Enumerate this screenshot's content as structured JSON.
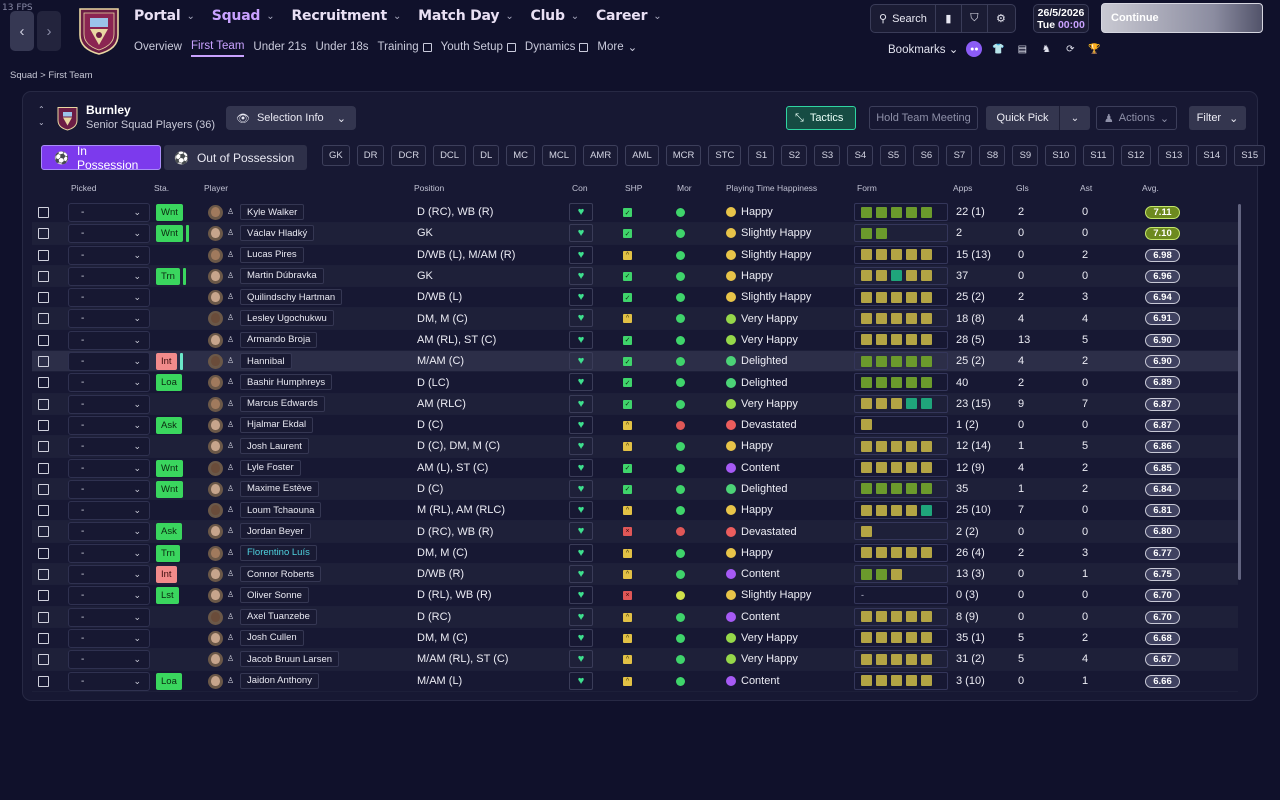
{
  "fps": "13 FPS",
  "menu": [
    {
      "label": "Portal",
      "active": false
    },
    {
      "label": "Squad",
      "active": true
    },
    {
      "label": "Recruitment",
      "active": false
    },
    {
      "label": "Match Day",
      "active": false
    },
    {
      "label": "Club",
      "active": false
    },
    {
      "label": "Career",
      "active": false
    }
  ],
  "submenu": [
    {
      "label": "Overview",
      "active": false,
      "ext": false
    },
    {
      "label": "First Team",
      "active": true,
      "ext": false
    },
    {
      "label": "Under 21s",
      "active": false,
      "ext": false
    },
    {
      "label": "Under 18s",
      "active": false,
      "ext": false
    },
    {
      "label": "Training",
      "active": false,
      "ext": true
    },
    {
      "label": "Youth Setup",
      "active": false,
      "ext": true
    },
    {
      "label": "Dynamics",
      "active": false,
      "ext": true
    },
    {
      "label": "More",
      "active": false,
      "ext": false,
      "dropdown": true
    }
  ],
  "topbar": {
    "search_label": "Search",
    "date": "26/5/2026",
    "day": "Tue",
    "time": "00:00",
    "continue_label": "Continue",
    "bookmarks_label": "Bookmarks"
  },
  "breadcrumb": {
    "root": "Squad",
    "current": "First Team"
  },
  "team": {
    "name": "Burnley",
    "subtitle": "Senior Squad Players (36)"
  },
  "buttons": {
    "selection_info": "Selection Info",
    "tactics": "Tactics",
    "hold_meeting": "Hold Team Meeting",
    "quick_pick": "Quick Pick",
    "actions": "Actions",
    "filter": "Filter",
    "in_possession": "In Possession",
    "out_possession": "Out of Possession"
  },
  "positions": [
    "GK",
    "DR",
    "DCR",
    "DCL",
    "DL",
    "MC",
    "MCL",
    "AMR",
    "AML",
    "MCR",
    "STC",
    "S1",
    "S2",
    "S3",
    "S4",
    "S5",
    "S6",
    "S7",
    "S8",
    "S9",
    "S10",
    "S11",
    "S12",
    "S13",
    "S14",
    "S15"
  ],
  "columns": {
    "picked": "Picked",
    "sta": "Sta.",
    "player": "Player",
    "position": "Position",
    "con": "Con",
    "shp": "SHP",
    "mor": "Mor",
    "happiness": "Playing Time Happiness",
    "form": "Form",
    "apps": "Apps",
    "gls": "Gls",
    "ast": "Ast",
    "avg": "Avg."
  },
  "picked_default": "-",
  "players": [
    {
      "name": "Kyle Walker",
      "sta": "Wnt",
      "sta_c": "g",
      "bar": "",
      "pos": "D (RC), WB (R)",
      "shp": "g",
      "mor": "g",
      "hap": "Happy",
      "emo": "y",
      "form": [
        "o",
        "o",
        "o",
        "o",
        "o"
      ],
      "apps": "22 (1)",
      "gls": "2",
      "ast": "0",
      "avg": "7.11",
      "avgc": "gr",
      "skin": "md"
    },
    {
      "name": "Václav Hladký",
      "sta": "Wnt",
      "sta_c": "g",
      "bar": "g",
      "pos": "GK",
      "shp": "g",
      "mor": "g",
      "hap": "Slightly Happy",
      "emo": "y",
      "form": [
        "o",
        "o"
      ],
      "apps": "2",
      "gls": "0",
      "ast": "0",
      "avg": "7.10",
      "avgc": "gr",
      "skin": ""
    },
    {
      "name": "Lucas Pires",
      "sta": "",
      "sta_c": "",
      "bar": "",
      "pos": "D/WB (L), M/AM (R)",
      "shp": "y",
      "mor": "g",
      "hap": "Slightly Happy",
      "emo": "y",
      "form": [
        "y",
        "y",
        "y",
        "y",
        "y"
      ],
      "apps": "15 (13)",
      "gls": "0",
      "ast": "2",
      "avg": "6.98",
      "avgc": "",
      "skin": "md"
    },
    {
      "name": "Martin Dúbravka",
      "sta": "Trn",
      "sta_c": "g",
      "bar": "g",
      "pos": "GK",
      "shp": "g",
      "mor": "g",
      "hap": "Happy",
      "emo": "y",
      "form": [
        "y",
        "y",
        "t",
        "y",
        "y"
      ],
      "apps": "37",
      "gls": "0",
      "ast": "0",
      "avg": "6.96",
      "avgc": "",
      "skin": ""
    },
    {
      "name": "Quilindschy Hartman",
      "sta": "",
      "sta_c": "",
      "bar": "",
      "pos": "D/WB (L)",
      "shp": "g",
      "mor": "g",
      "hap": "Slightly Happy",
      "emo": "y",
      "form": [
        "y",
        "y",
        "y",
        "y",
        "y"
      ],
      "apps": "25 (2)",
      "gls": "2",
      "ast": "3",
      "avg": "6.94",
      "avgc": "",
      "skin": ""
    },
    {
      "name": "Lesley Ugochukwu",
      "sta": "",
      "sta_c": "",
      "bar": "",
      "pos": "DM, M (C)",
      "shp": "y",
      "mor": "g",
      "hap": "Very Happy",
      "emo": "lg",
      "form": [
        "y",
        "y",
        "y",
        "y",
        "y"
      ],
      "apps": "18 (8)",
      "gls": "4",
      "ast": "4",
      "avg": "6.91",
      "avgc": "",
      "skin": "dk"
    },
    {
      "name": "Armando Broja",
      "sta": "",
      "sta_c": "",
      "bar": "",
      "pos": "AM (RL), ST (C)",
      "shp": "g",
      "mor": "g",
      "hap": "Very Happy",
      "emo": "lg",
      "form": [
        "y",
        "y",
        "y",
        "y",
        "y"
      ],
      "apps": "28 (5)",
      "gls": "13",
      "ast": "5",
      "avg": "6.90",
      "avgc": "",
      "skin": ""
    },
    {
      "name": "Hannibal",
      "sta": "Int",
      "sta_c": "r",
      "bar": "t",
      "pos": "M/AM (C)",
      "shp": "g",
      "mor": "g",
      "hap": "Delighted",
      "emo": "g",
      "form": [
        "o",
        "o",
        "o",
        "o",
        "o"
      ],
      "apps": "25 (2)",
      "gls": "4",
      "ast": "2",
      "avg": "6.90",
      "avgc": "",
      "skin": "dk"
    },
    {
      "name": "Bashir Humphreys",
      "sta": "Loa",
      "sta_c": "g",
      "bar": "",
      "pos": "D (LC)",
      "shp": "g",
      "mor": "g",
      "hap": "Delighted",
      "emo": "g",
      "form": [
        "o",
        "o",
        "o",
        "o",
        "o"
      ],
      "apps": "40",
      "gls": "2",
      "ast": "0",
      "avg": "6.89",
      "avgc": "",
      "skin": "md"
    },
    {
      "name": "Marcus Edwards",
      "sta": "",
      "sta_c": "",
      "bar": "",
      "pos": "AM (RLC)",
      "shp": "g",
      "mor": "g",
      "hap": "Very Happy",
      "emo": "lg",
      "form": [
        "y",
        "y",
        "y",
        "t",
        "t"
      ],
      "apps": "23 (15)",
      "gls": "9",
      "ast": "7",
      "avg": "6.87",
      "avgc": "",
      "skin": "md"
    },
    {
      "name": "Hjalmar Ekdal",
      "sta": "Ask",
      "sta_c": "g",
      "bar": "",
      "pos": "D (C)",
      "shp": "y",
      "mor": "r",
      "hap": "Devastated",
      "emo": "r",
      "form": [
        "y"
      ],
      "apps": "1 (2)",
      "gls": "0",
      "ast": "0",
      "avg": "6.87",
      "avgc": "",
      "skin": ""
    },
    {
      "name": "Josh Laurent",
      "sta": "",
      "sta_c": "",
      "bar": "",
      "pos": "D (C), DM, M (C)",
      "shp": "y",
      "mor": "g",
      "hap": "Happy",
      "emo": "y",
      "form": [
        "y",
        "y",
        "y",
        "y",
        "y"
      ],
      "apps": "12 (14)",
      "gls": "1",
      "ast": "5",
      "avg": "6.86",
      "avgc": "",
      "skin": ""
    },
    {
      "name": "Lyle Foster",
      "sta": "Wnt",
      "sta_c": "g",
      "bar": "",
      "pos": "AM (L), ST (C)",
      "shp": "g",
      "mor": "g",
      "hap": "Content",
      "emo": "p",
      "form": [
        "y",
        "y",
        "y",
        "y",
        "y"
      ],
      "apps": "12 (9)",
      "gls": "4",
      "ast": "2",
      "avg": "6.85",
      "avgc": "",
      "skin": "dk"
    },
    {
      "name": "Maxime Estève",
      "sta": "Wnt",
      "sta_c": "g",
      "bar": "",
      "pos": "D (C)",
      "shp": "g",
      "mor": "g",
      "hap": "Delighted",
      "emo": "g",
      "form": [
        "o",
        "o",
        "o",
        "o",
        "o"
      ],
      "apps": "35",
      "gls": "1",
      "ast": "2",
      "avg": "6.84",
      "avgc": "",
      "skin": ""
    },
    {
      "name": "Loum Tchaouna",
      "sta": "",
      "sta_c": "",
      "bar": "",
      "pos": "M (RL), AM (RLC)",
      "shp": "y",
      "mor": "g",
      "hap": "Happy",
      "emo": "y",
      "form": [
        "y",
        "y",
        "y",
        "y",
        "t"
      ],
      "apps": "25 (10)",
      "gls": "7",
      "ast": "0",
      "avg": "6.81",
      "avgc": "",
      "skin": "dk"
    },
    {
      "name": "Jordan Beyer",
      "sta": "Ask",
      "sta_c": "g",
      "bar": "",
      "pos": "D (RC), WB (R)",
      "shp": "r",
      "mor": "r",
      "hap": "Devastated",
      "emo": "r",
      "form": [
        "y"
      ],
      "apps": "2 (2)",
      "gls": "0",
      "ast": "0",
      "avg": "6.80",
      "avgc": "",
      "skin": ""
    },
    {
      "name": "Florentino Luís",
      "sta": "Trn",
      "sta_c": "g",
      "bar": "",
      "pos": "DM, M (C)",
      "shp": "y",
      "mor": "g",
      "hap": "Happy",
      "emo": "y",
      "form": [
        "y",
        "y",
        "y",
        "y",
        "y"
      ],
      "apps": "26 (4)",
      "gls": "2",
      "ast": "3",
      "avg": "6.77",
      "avgc": "",
      "skin": "md",
      "link": true
    },
    {
      "name": "Connor Roberts",
      "sta": "Int",
      "sta_c": "r",
      "bar": "",
      "pos": "D/WB (R)",
      "shp": "y",
      "mor": "g",
      "hap": "Content",
      "emo": "p",
      "form": [
        "o",
        "o",
        "y"
      ],
      "apps": "13 (3)",
      "gls": "0",
      "ast": "1",
      "avg": "6.75",
      "avgc": "",
      "skin": ""
    },
    {
      "name": "Oliver Sonne",
      "sta": "Lst",
      "sta_c": "g",
      "bar": "",
      "pos": "D (RL), WB (R)",
      "shp": "r",
      "mor": "y",
      "hap": "Slightly Happy",
      "emo": "y",
      "form": [],
      "form_text": "-",
      "apps": "0 (3)",
      "gls": "0",
      "ast": "0",
      "avg": "6.70",
      "avgc": "",
      "skin": ""
    },
    {
      "name": "Axel Tuanzebe",
      "sta": "",
      "sta_c": "",
      "bar": "",
      "pos": "D (RC)",
      "shp": "y",
      "mor": "g",
      "hap": "Content",
      "emo": "p",
      "form": [
        "y",
        "y",
        "y",
        "y",
        "y"
      ],
      "apps": "8 (9)",
      "gls": "0",
      "ast": "0",
      "avg": "6.70",
      "avgc": "",
      "skin": "dk"
    },
    {
      "name": "Josh Cullen",
      "sta": "",
      "sta_c": "",
      "bar": "",
      "pos": "DM, M (C)",
      "shp": "y",
      "mor": "g",
      "hap": "Very Happy",
      "emo": "lg",
      "form": [
        "y",
        "y",
        "y",
        "y",
        "y"
      ],
      "apps": "35 (1)",
      "gls": "5",
      "ast": "2",
      "avg": "6.68",
      "avgc": "",
      "skin": ""
    },
    {
      "name": "Jacob Bruun Larsen",
      "sta": "",
      "sta_c": "",
      "bar": "",
      "pos": "M/AM (RL), ST (C)",
      "shp": "y",
      "mor": "g",
      "hap": "Very Happy",
      "emo": "lg",
      "form": [
        "y",
        "y",
        "y",
        "y",
        "y"
      ],
      "apps": "31 (2)",
      "gls": "5",
      "ast": "4",
      "avg": "6.67",
      "avgc": "",
      "skin": ""
    },
    {
      "name": "Jaidon Anthony",
      "sta": "Loa",
      "sta_c": "g",
      "bar": "",
      "pos": "M/AM (L)",
      "shp": "y",
      "mor": "g",
      "hap": "Content",
      "emo": "p",
      "form": [
        "y",
        "y",
        "y",
        "y",
        "y"
      ],
      "apps": "3 (10)",
      "gls": "0",
      "ast": "1",
      "avg": "6.66",
      "avgc": "",
      "skin": ""
    }
  ]
}
